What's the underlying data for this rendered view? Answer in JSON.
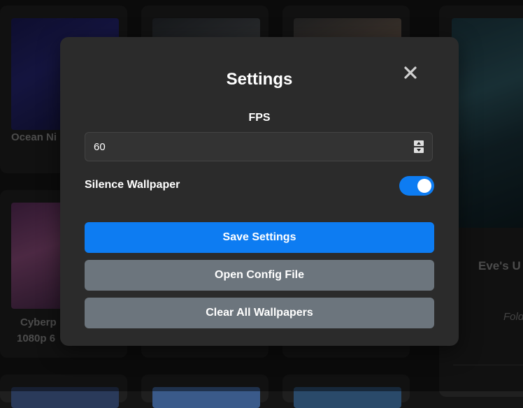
{
  "gallery": {
    "cards": [
      {
        "title": "Ocean Ni"
      },
      {
        "title": "Cyberp"
      },
      {
        "title": "1080p 6"
      }
    ],
    "side_panel": {
      "title": "Eve's U",
      "meta": "Fold"
    }
  },
  "settings_modal": {
    "title": "Settings",
    "close_icon": "close-icon",
    "fps": {
      "label": "FPS",
      "value": "60"
    },
    "silence_wallpaper": {
      "label": "Silence Wallpaper",
      "enabled": true
    },
    "buttons": {
      "save": "Save Settings",
      "open_config": "Open Config File",
      "clear_all": "Clear All Wallpapers"
    },
    "colors": {
      "primary": "#0d7cf2",
      "secondary": "#6c757d",
      "modal_bg": "#2b2b2b"
    }
  }
}
